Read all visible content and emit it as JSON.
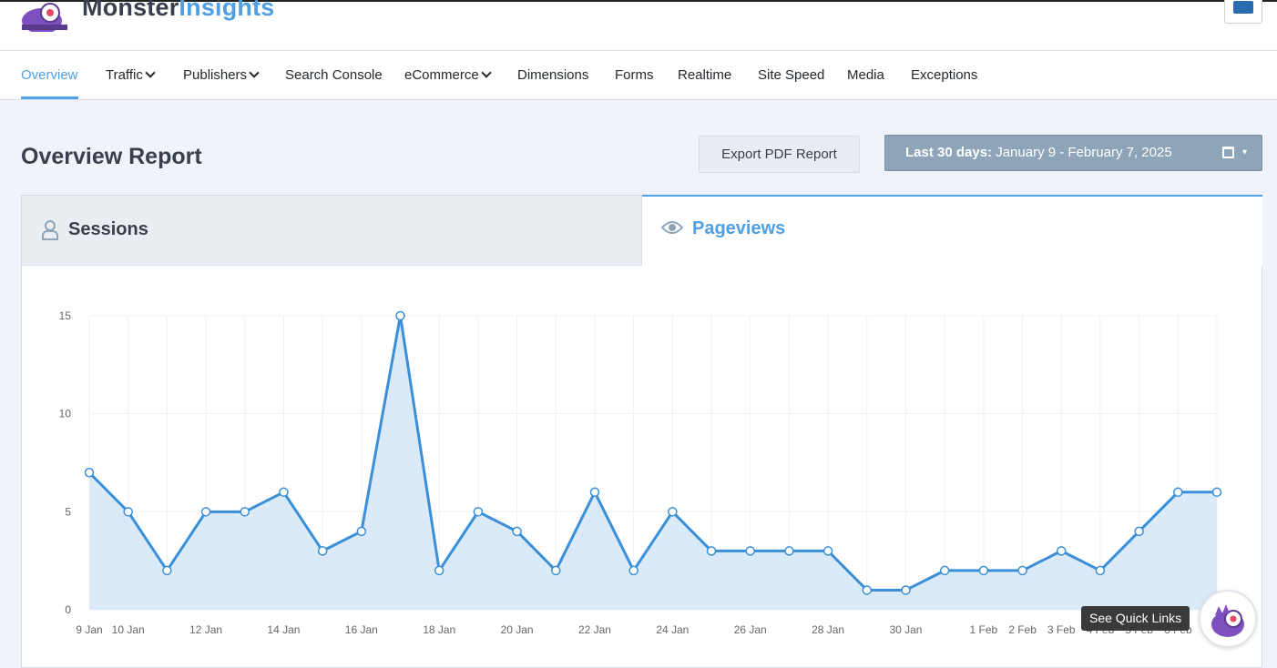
{
  "brand": {
    "name_part1": "Monster",
    "name_part2": "Insights",
    "logo_icon": "monster-logo-icon",
    "accent": "#509fe2"
  },
  "nav": {
    "items": [
      {
        "label": "Overview",
        "active": true
      },
      {
        "label": "Traffic",
        "dropdown": true
      },
      {
        "label": "Publishers",
        "dropdown": true
      },
      {
        "label": "Search Console"
      },
      {
        "label": "eCommerce",
        "dropdown": true
      },
      {
        "label": "Dimensions"
      },
      {
        "label": "Forms"
      },
      {
        "label": "Realtime"
      },
      {
        "label": "Site Speed"
      },
      {
        "label": "Media"
      },
      {
        "label": "Exceptions"
      }
    ]
  },
  "header": {
    "title": "Overview Report",
    "export_label": "Export PDF Report",
    "date_range_prefix": "Last 30 days:",
    "date_range_value": "January 9 - February 7, 2025"
  },
  "tabs": {
    "sessions_label": "Sessions",
    "pageviews_label": "Pageviews"
  },
  "chart_data": {
    "type": "area",
    "x": [
      "9 Jan",
      "10 Jan",
      "11 Jan",
      "12 Jan",
      "13 Jan",
      "14 Jan",
      "15 Jan",
      "16 Jan",
      "17 Jan",
      "18 Jan",
      "19 Jan",
      "20 Jan",
      "21 Jan",
      "22 Jan",
      "23 Jan",
      "24 Jan",
      "25 Jan",
      "26 Jan",
      "27 Jan",
      "28 Jan",
      "29 Jan",
      "30 Jan",
      "31 Jan",
      "1 Feb",
      "2 Feb",
      "3 Feb",
      "4 Feb",
      "5 Feb",
      "6 Feb",
      "7 Feb"
    ],
    "series": [
      {
        "values": [
          7,
          5,
          2,
          5,
          5,
          6,
          3,
          4,
          15,
          2,
          5,
          4,
          2,
          6,
          2,
          5,
          3,
          3,
          3,
          3,
          1,
          1,
          2,
          2,
          2,
          3,
          2,
          4,
          6,
          6
        ]
      }
    ],
    "x_tick_labels": [
      "9 Jan",
      "10 Jan",
      "12 Jan",
      "14 Jan",
      "16 Jan",
      "18 Jan",
      "20 Jan",
      "22 Jan",
      "24 Jan",
      "26 Jan",
      "28 Jan",
      "30 Jan",
      "1 Feb",
      "2 Feb",
      "3 Feb",
      "4 Feb",
      "5 Feb",
      "6 Feb"
    ],
    "y_ticks": [
      0,
      5,
      10,
      15
    ],
    "ylim": [
      0,
      15
    ],
    "grid": true,
    "line_color": "#3a8fd8",
    "fill_color": "#dbeaf8"
  },
  "quick_links": {
    "label": "See Quick Links",
    "icon": "monster-mascot-icon"
  }
}
